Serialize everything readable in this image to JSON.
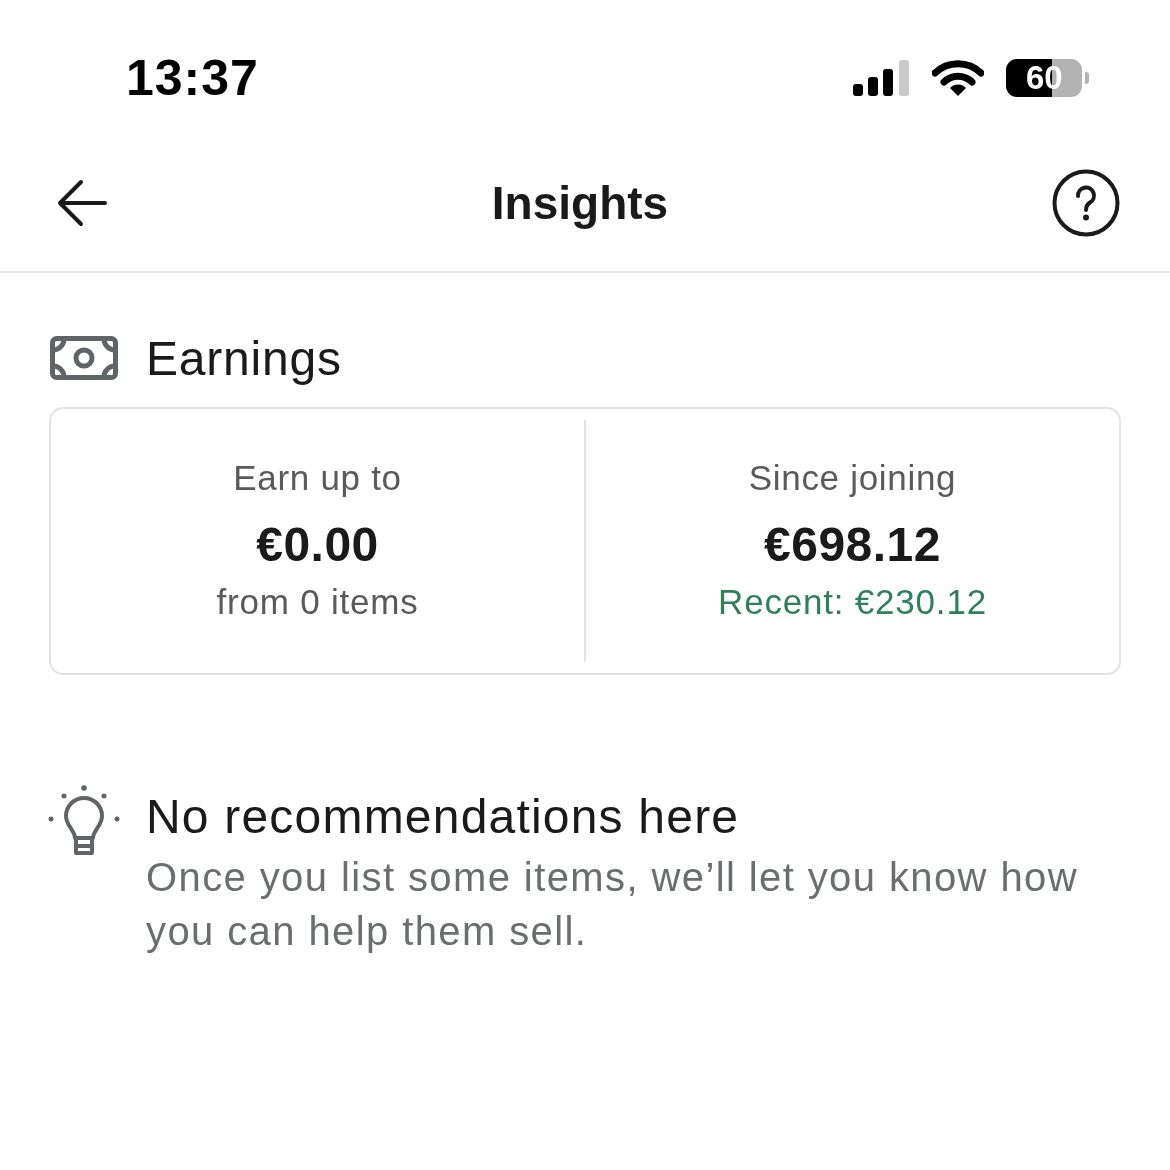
{
  "status_bar": {
    "time": "13:37",
    "battery": "60"
  },
  "header": {
    "title": "Insights"
  },
  "earnings": {
    "title": "Earnings",
    "stats": [
      {
        "label": "Earn up to",
        "amount": "€0.00",
        "note": "from 0 items",
        "kind": "plain"
      },
      {
        "label": "Since joining",
        "amount": "€698.12",
        "note": "Recent: €230.12",
        "kind": "positive"
      }
    ]
  },
  "recommendations": {
    "title": "No recommendations here",
    "body": "Once you list some items, we’ll let you know how you can help them sell."
  }
}
